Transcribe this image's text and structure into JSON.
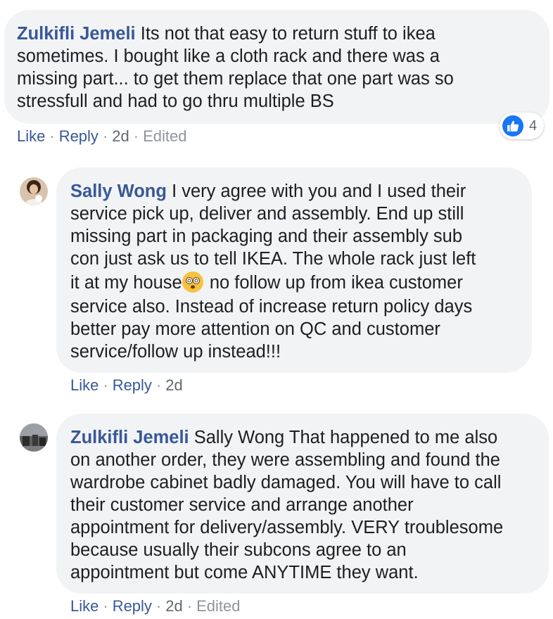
{
  "comments": [
    {
      "author": "Zulkifli Jemeli",
      "lines": [
        "Its not that easy to return stuff to ikea",
        "sometimes. I bought like a cloth rack and there was a",
        "missing part... to get them replace that one part was so",
        "stressfull and had to go thru multiple BS"
      ],
      "like_label": "Like",
      "reply_label": "Reply",
      "time": "2d",
      "edited_label": "Edited",
      "reaction_count": "4"
    },
    {
      "author": "Sally Wong",
      "lines": [
        "I very agree with you and I used their",
        "service pick up, deliver and assembly. End up still",
        "missing part in packaging and their assembly sub",
        "con just ask us to tell IKEA. The whole rack just left",
        "it at my house",
        " no follow up from ikea customer",
        "service also. Instead of increase return policy days",
        "better pay more attention on QC and customer",
        "service/follow up instead!!!"
      ],
      "like_label": "Like",
      "reply_label": "Reply",
      "time": "2d"
    },
    {
      "author": "Zulkifli Jemeli",
      "mention": "Sally Wong",
      "lines": [
        "That happened to me also",
        "on another order, they were assembling and found the",
        "wardrobe cabinet badly damaged. You will have to call",
        "their customer service and arrange another",
        "appointment for delivery/assembly. VERY troublesome",
        "because usually their subcons agree to an",
        "appointment but come ANYTIME they want."
      ],
      "like_label": "Like",
      "reply_label": "Reply",
      "time": "2d",
      "edited_label": "Edited"
    }
  ],
  "icons": {
    "like_reaction": "thumbs-up-icon",
    "emoji": "dizzy-face-emoji-icon"
  },
  "colors": {
    "author": "#385898",
    "bubble": "#f2f3f5",
    "meta": "#606770",
    "like_badge": "#1877f2"
  }
}
